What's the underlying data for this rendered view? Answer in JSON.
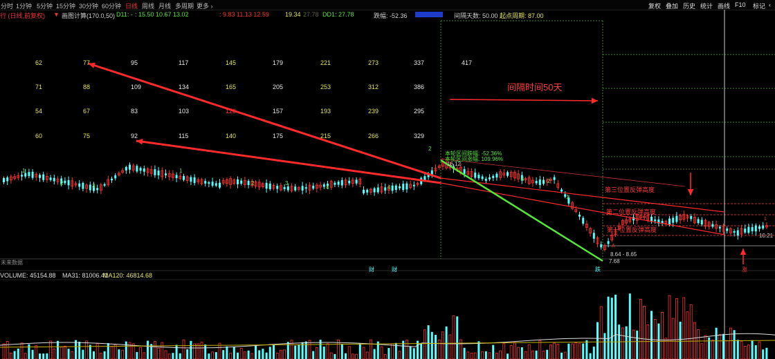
{
  "toolbar": {
    "periods": [
      "分时",
      "1分钟",
      "5分钟",
      "15分钟",
      "30分钟",
      "60分钟",
      "日线",
      "周线",
      "月线",
      "多周期",
      "更多 ›"
    ],
    "active_period": "日线",
    "right_items": [
      "复权",
      "叠加",
      "历史",
      "统计",
      "画线",
      "F10",
      "标记",
      "‹"
    ]
  },
  "info_bar": {
    "stock_label": "行 (日线,前复权)",
    "indicator_name": "画图计算(170.0,50)",
    "d11_label": "D11: -",
    "d11_values": ": 15.50  10.67  13.02",
    "red_values": ": 9.83  11.13  12.59",
    "yellow_value": "19.34",
    "dim_value": "27.78",
    "dd1_label": "DD1: 27.78",
    "drop_label": "跌幅: -52.36",
    "interval_days": "间隔天数: 50.00",
    "start_cycle": "起点周期: 87.00"
  },
  "number_grid": {
    "rows": [
      [
        "62",
        "77",
        "95",
        "117",
        "145",
        "179",
        "221",
        "273",
        "337",
        "417"
      ],
      [
        "71",
        "88",
        "109",
        "134",
        "165",
        "205",
        "253",
        "312",
        "386"
      ],
      [
        "54",
        "67",
        "83",
        "103",
        "126",
        "157",
        "193",
        "239",
        "295"
      ],
      [
        "60",
        "75",
        "92",
        "115",
        "140",
        "175",
        "215",
        "266",
        "329"
      ]
    ],
    "red_cells": [
      "126"
    ],
    "yellow_cells": [
      "62",
      "77",
      "71",
      "88",
      "54",
      "67",
      "60",
      "75",
      "145",
      "165",
      "140",
      "221",
      "253",
      "193",
      "215",
      "273",
      "312",
      "239",
      "266"
    ]
  },
  "annotations": {
    "interval_50": "间隔时间50天",
    "third_rebound": "第三位置反弹高度",
    "second_rebound": "第二位置反弹高度",
    "first_rebound": "第一位置反弹高度",
    "future_data": "未来数据",
    "high_label": "16.12",
    "range_label": "8.64 - 8.65",
    "low_label": "7.68",
    "right_price": "10.21",
    "green_box_1": "本轮区间跌幅: -52.36%",
    "green_box_2": "本轮区间涨幅: 109.96%",
    "marker_cai": "财",
    "marker_cai2": "财",
    "marker_die": "跌",
    "marker_zhang": "涨",
    "small_marker_a": "A",
    "right_one": "1"
  },
  "volume": {
    "label": "VOLUME: 45154.88",
    "ma31": "MA31: 81006.41",
    "ma120": "MA120: 46814.68"
  },
  "colors": {
    "up": "#ff3232",
    "down": "#54ffff",
    "yellow": "#e6e65a",
    "green": "#56e63a",
    "ma_white": "#dddddd",
    "ma_yellow": "#c8b400"
  }
}
